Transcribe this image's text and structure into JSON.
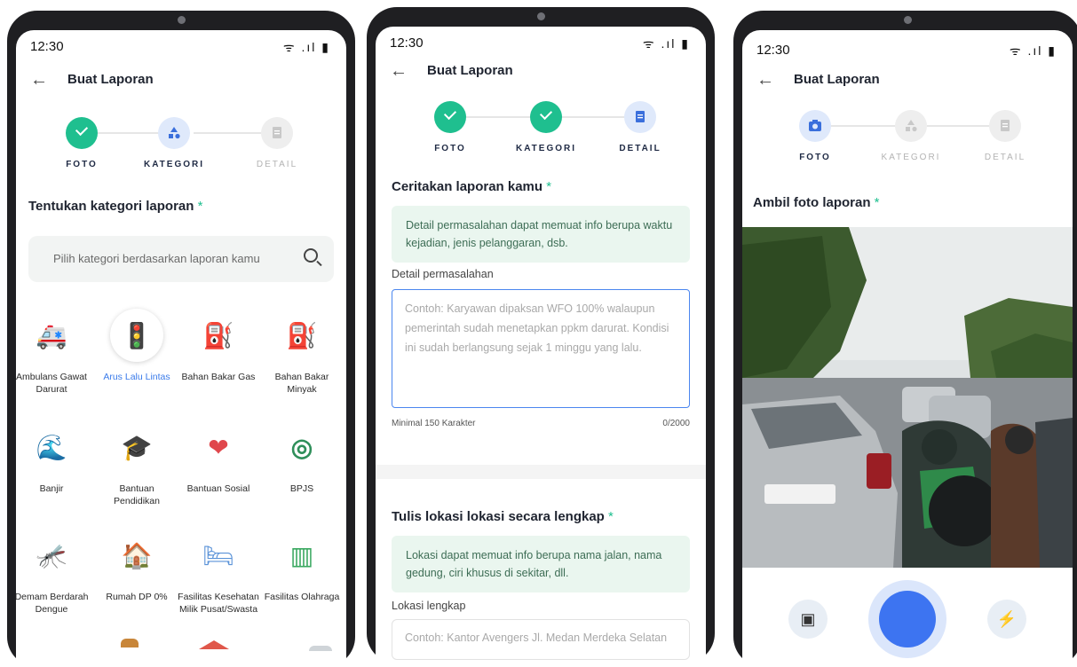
{
  "status": {
    "time": "12:30",
    "icons": "ᯤ .ıl ▮"
  },
  "header": {
    "back": "←",
    "title": "Buat Laporan"
  },
  "steps": {
    "foto": "FOTO",
    "kategori": "KATEGORI",
    "detail": "DETAIL"
  },
  "screen1": {
    "section_title": "Tentukan kategori laporan",
    "required_mark": "*",
    "search_placeholder": "Pilih kategori berdasarkan laporan kamu",
    "categories": [
      {
        "label": "Ambulans Gawat Darurat",
        "icon": "ambulance-icon",
        "glyph": "🚑"
      },
      {
        "label": "Arus Lalu Lintas",
        "icon": "traffic-light-icon",
        "glyph": "🚦",
        "selected": true
      },
      {
        "label": "Bahan Bakar Gas",
        "icon": "gas-pump-icon",
        "glyph": "⛽"
      },
      {
        "label": "Bahan Bakar Minyak",
        "icon": "fuel-nozzle-icon",
        "glyph": "⛽"
      },
      {
        "label": "Banjir",
        "icon": "flood-icon",
        "glyph": "🌊"
      },
      {
        "label": "Bantuan Pendidikan",
        "icon": "graduation-cap-icon",
        "glyph": "🎓"
      },
      {
        "label": "Bantuan Sosial",
        "icon": "heart-hand-icon",
        "glyph": "❤"
      },
      {
        "label": "BPJS",
        "icon": "bpjs-logo-icon",
        "glyph": "◎"
      },
      {
        "label": "Demam Berdarah Dengue",
        "icon": "mosquito-icon",
        "glyph": "🦟"
      },
      {
        "label": "Rumah DP 0%",
        "icon": "house-tag-icon",
        "glyph": "🏠"
      },
      {
        "label": "Fasilitas Kesehatan Milik Pusat/Swasta",
        "icon": "hospital-bed-icon",
        "glyph": "🛏"
      },
      {
        "label": "Fasilitas Olahraga",
        "icon": "field-icon",
        "glyph": "▥"
      }
    ]
  },
  "screen2": {
    "section1_title": "Ceritakan laporan kamu",
    "info1": "Detail permasalahan dapat memuat info berupa waktu kejadian, jenis pelanggaran, dsb.",
    "field1_label": "Detail permasalahan",
    "field1_placeholder": "Contoh: Karyawan dipaksan WFO 100% walaupun pemerintah sudah menetapkan ppkm darurat. Kondisi ini sudah berlangsung sejak 1 minggu yang lalu.",
    "min_hint": "Minimal 150 Karakter",
    "counter": "0/2000",
    "section2_title": "Tulis lokasi lokasi secara lengkap",
    "info2": "Lokasi dapat memuat info berupa nama jalan, nama gedung, ciri khusus di sekitar, dll.",
    "field2_label": "Lokasi lengkap",
    "field2_placeholder": "Contoh: Kantor Avengers Jl. Medan Merdeka Selatan"
  },
  "screen3": {
    "section_title": "Ambil foto laporan",
    "gallery_icon": "▣",
    "flash_icon": "⚡"
  },
  "colors": {
    "green": "#1fbf8f",
    "blue": "#3d74f1",
    "info_bg": "#eaf6ef"
  }
}
